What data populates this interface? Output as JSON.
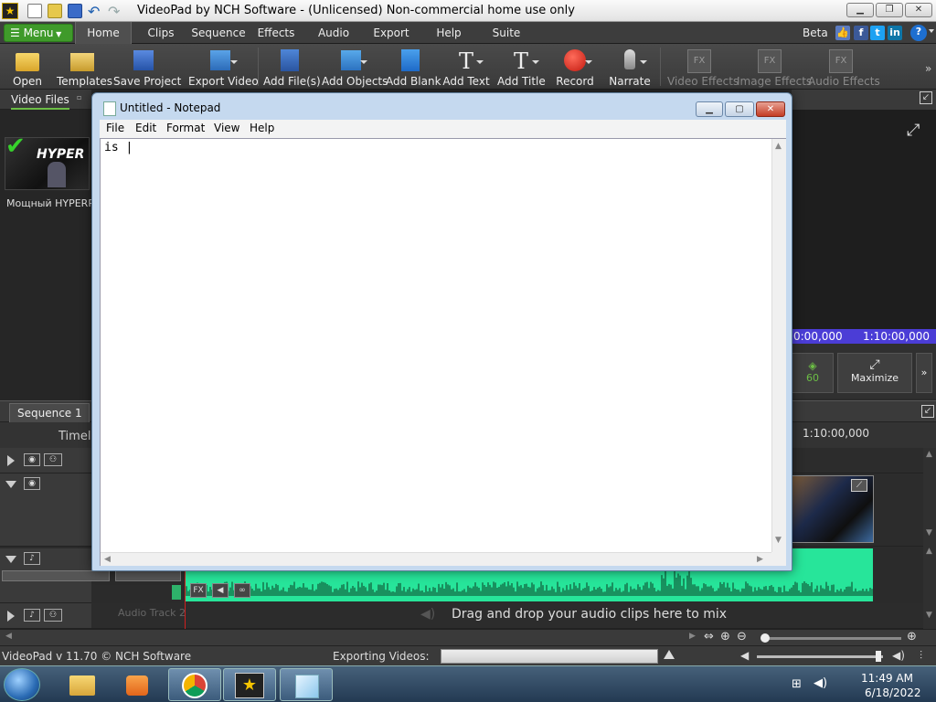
{
  "app": {
    "title": "VideoPad by NCH Software - (Unlicensed) Non-commercial home use only",
    "accent": "#3f9a2a"
  },
  "tabs": {
    "menu": "Menu",
    "items": [
      "Home",
      "Clips",
      "Sequence",
      "Effects",
      "Audio",
      "Export",
      "Help",
      "Suite"
    ],
    "beta": "Beta"
  },
  "toolbar": {
    "open": "Open",
    "templates": "Templates",
    "save_project": "Save Project",
    "export_video": "Export Video",
    "add_files": "Add File(s)",
    "add_objects": "Add Objects",
    "add_blank": "Add Blank",
    "add_text": "Add Text",
    "add_title": "Add Title",
    "record": "Record",
    "narrate": "Narrate",
    "video_effects": "Video Effects",
    "image_effects": "Image Effects",
    "audio_effects": "Audio Effects",
    "fx": "FX"
  },
  "bin": {
    "tab": "Video Files",
    "clip_label": "Мощный HYPERPC",
    "thumb_text": "HYPER"
  },
  "preview": {
    "timecode_left": "0:00,000",
    "timecode_right": "1:10:00,000",
    "fps": "60",
    "maximize": "Maximize"
  },
  "sequence": {
    "tab": "Sequence 1",
    "timeline_label": "Timeli",
    "ruler_time": "1:10:00,000",
    "audio_track_2": "Audio Track 2",
    "drop_hint": "Drag and drop your audio clips here to mix"
  },
  "status": {
    "version": "VideoPad v 11.70 © NCH Software",
    "exporting": "Exporting Videos:"
  },
  "taskbar": {
    "time": "11:49 AM",
    "date": "6/18/2022"
  },
  "notepad": {
    "title": "Untitled - Notepad",
    "menu": [
      "File",
      "Edit",
      "Format",
      "View",
      "Help"
    ],
    "text": "is |"
  }
}
